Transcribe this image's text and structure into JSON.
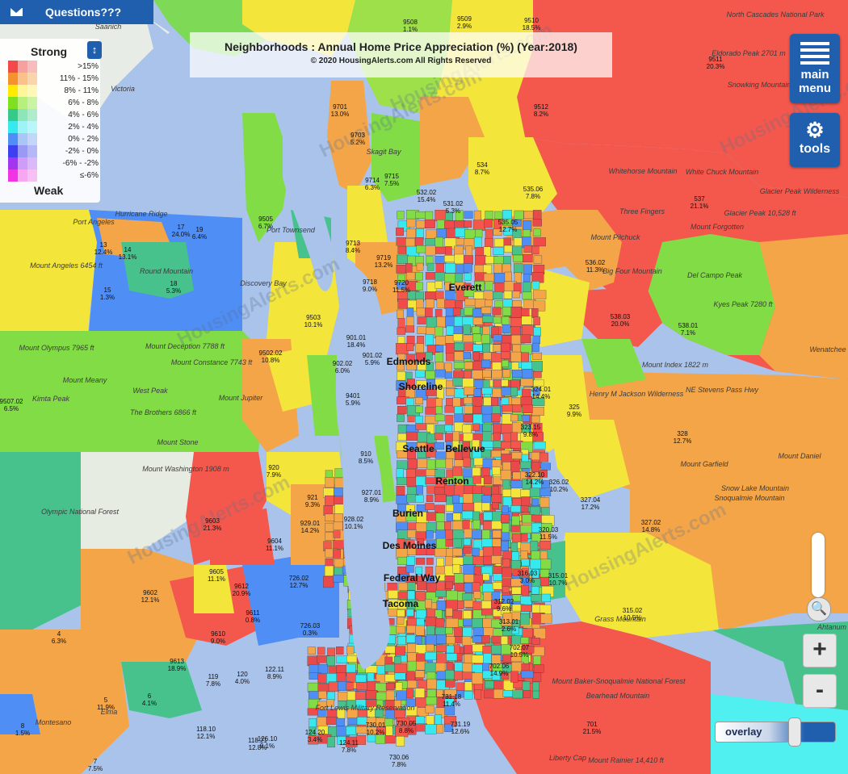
{
  "questions": {
    "label": "Questions???"
  },
  "title": {
    "heading": "Neighborhoods : Annual Home Price Appreciation (%) (Year:2018)",
    "copyright": "© 2020 HousingAlerts.com All Rights Reserved"
  },
  "legend": {
    "top": "Strong",
    "bottom": "Weak",
    "rows": [
      {
        "label": ">15%",
        "c1": "#f24a4a",
        "c2": "#f7a0a0"
      },
      {
        "label": "11% - 15%",
        "c1": "#f5922f",
        "c2": "#f8c28a"
      },
      {
        "label": "8% - 11%",
        "c1": "#ffea00",
        "c2": "#fff59a"
      },
      {
        "label": "6% - 8%",
        "c1": "#7ee01f",
        "c2": "#b8f07e"
      },
      {
        "label": "4% - 6%",
        "c1": "#36c98c",
        "c2": "#8ee6b8"
      },
      {
        "label": "2% - 4%",
        "c1": "#37e9ef",
        "c2": "#9df3f6"
      },
      {
        "label": "0% - 2%",
        "c1": "#4f8ef5",
        "c2": "#a9c6f7"
      },
      {
        "label": "-2% - 0%",
        "c1": "#3f3ff2",
        "c2": "#9a9af5"
      },
      {
        "label": "-6% - -2%",
        "c1": "#a234f2",
        "c2": "#cf9cf7"
      },
      {
        "label": "≤-6%",
        "c1": "#f233e3",
        "c2": "#f7a6ef"
      }
    ]
  },
  "buttons": {
    "menu": "main menu",
    "tools": "tools",
    "zoom_in": "+",
    "zoom_out": "-",
    "overlay": "overlay"
  },
  "icons": {
    "mail": "mail-icon",
    "menu": "hamburger-icon",
    "tools": "gear-icon",
    "zoom": "magnifier-icon",
    "legend_toggle": "expand-vertical-icon"
  },
  "map": {
    "watermark": "HousingAlerts.com",
    "cities": [
      "Seattle",
      "Bellevue",
      "Tacoma",
      "Everett",
      "Edmonds",
      "Shoreline",
      "Burien",
      "Des Moines",
      "Renton",
      "Federal Way"
    ],
    "places": [
      "Saanich",
      "Victoria",
      "Port Angeles",
      "Mount Angeles 6454 ft",
      "Mount Olympus 7965 ft",
      "Mount Deception 7788 ft",
      "Mount Constance 7743 ft",
      "The Brothers 6866 ft",
      "Mount Washington 1908 m",
      "Olympic National Forest",
      "Mount Stone",
      "Mount Jupiter",
      "Mount Meany",
      "West Peak",
      "Kimta Peak",
      "Hurricane Ridge",
      "Round Mountain",
      "Discovery Bay",
      "Port Townsend",
      "Skagit Bay",
      "North Cascades National Park",
      "Eldorado Peak 2701 m",
      "Snowking Mountain",
      "Whitehorse Mountain",
      "White Chuck Mountain",
      "Three Fingers",
      "Mount Forgotten",
      "Glacier Peak 10,528 ft",
      "Glacier Peak Wilderness",
      "Mount Pilchuck",
      "Big Four Mountain",
      "Del Campo Peak",
      "Kyes Peak 7280 ft",
      "Mount Index 1822 m",
      "Henry M Jackson Wilderness",
      "NE Stevens Pass Hwy",
      "Wenatchee",
      "Mount Garfield",
      "Mount Daniel",
      "Snoqualmie Mountain",
      "Snow Lake Mountain",
      "Mount Baker-Snoqualmie National Forest",
      "Bearhead Mountain",
      "Mount Rainier 14,410 ft",
      "Liberty Cap",
      "Grass Mountain",
      "Fort Lewis Military Reservation",
      "Montesano",
      "Elma",
      "Ahtanum"
    ],
    "region_labels": [
      {
        "id": "9509",
        "v": "2.9%"
      },
      {
        "id": "9510",
        "v": "18.5%"
      },
      {
        "id": "9508",
        "v": "1.1%"
      },
      {
        "id": "9511",
        "v": "20.3%"
      },
      {
        "id": "9512",
        "v": "8.2%"
      },
      {
        "id": "9701",
        "v": "13.0%"
      },
      {
        "id": "9703",
        "v": "5.2%"
      },
      {
        "id": "9714",
        "v": "6.3%"
      },
      {
        "id": "9715",
        "v": "7.5%"
      },
      {
        "id": "9505",
        "v": "6.7%"
      },
      {
        "id": "9713",
        "v": "8.4%"
      },
      {
        "id": "9719",
        "v": "13.2%"
      },
      {
        "id": "9718",
        "v": "9.0%"
      },
      {
        "id": "9720",
        "v": "11.5%"
      },
      {
        "id": "9503",
        "v": "10.1%"
      },
      {
        "id": "9502.02",
        "v": "10.8%"
      },
      {
        "id": "535.06",
        "v": "7.8%"
      },
      {
        "id": "537",
        "v": "21.1%"
      },
      {
        "id": "536.02",
        "v": "11.3%"
      },
      {
        "id": "538.03",
        "v": "20.0%"
      },
      {
        "id": "538.01",
        "v": "7.1%"
      },
      {
        "id": "534",
        "v": "8.7%"
      },
      {
        "id": "532.02",
        "v": "15.4%"
      },
      {
        "id": "531.02",
        "v": "5.3%"
      },
      {
        "id": "535.05",
        "v": "12.7%"
      },
      {
        "id": "325",
        "v": "9.9%"
      },
      {
        "id": "328",
        "v": "12.7%"
      },
      {
        "id": "324.01",
        "v": "14.4%"
      },
      {
        "id": "323.15",
        "v": "9.8%"
      },
      {
        "id": "322.10",
        "v": "14.2%"
      },
      {
        "id": "326.02",
        "v": "10.2%"
      },
      {
        "id": "327.04",
        "v": "17.2%"
      },
      {
        "id": "327.02",
        "v": "14.8%"
      },
      {
        "id": "320.03",
        "v": "11.5%"
      },
      {
        "id": "315.01",
        "v": "10.7%"
      },
      {
        "id": "315.02",
        "v": "10.5%"
      },
      {
        "id": "316.03",
        "v": "3.0%"
      },
      {
        "id": "312.02",
        "v": "9.6%"
      },
      {
        "id": "313.01",
        "v": "2.6%"
      },
      {
        "id": "702.07",
        "v": "10.5%"
      },
      {
        "id": "702.06",
        "v": "14.9%"
      },
      {
        "id": "701",
        "v": "21.5%"
      },
      {
        "id": "731.19",
        "v": "12.6%"
      },
      {
        "id": "731.18",
        "v": "11.4%"
      },
      {
        "id": "730.05",
        "v": "8.8%"
      },
      {
        "id": "730.01",
        "v": "10.2%"
      },
      {
        "id": "730.06",
        "v": "7.8%"
      },
      {
        "id": "124.20",
        "v": "3.4%"
      },
      {
        "id": "124.11",
        "v": "7.8%"
      },
      {
        "id": "126.10",
        "v": "9.1%"
      },
      {
        "id": "118.21",
        "v": "12.8%"
      },
      {
        "id": "118.10",
        "v": "12.1%"
      },
      {
        "id": "119",
        "v": "7.8%"
      },
      {
        "id": "120",
        "v": "4.0%"
      },
      {
        "id": "122.11",
        "v": "8.9%"
      },
      {
        "id": "9613",
        "v": "18.9%"
      },
      {
        "id": "9610",
        "v": "9.0%"
      },
      {
        "id": "9612",
        "v": "20.9%"
      },
      {
        "id": "9611",
        "v": "0.8%"
      },
      {
        "id": "9605",
        "v": "11.1%"
      },
      {
        "id": "9602",
        "v": "12.1%"
      },
      {
        "id": "9603",
        "v": "21.3%"
      },
      {
        "id": "9604",
        "v": "11.1%"
      },
      {
        "id": "726.03",
        "v": "0.3%"
      },
      {
        "id": "726.02",
        "v": "12.7%"
      },
      {
        "id": "921",
        "v": "9.3%"
      },
      {
        "id": "920",
        "v": "7.9%"
      },
      {
        "id": "929.01",
        "v": "14.2%"
      },
      {
        "id": "928.02",
        "v": "10.1%"
      },
      {
        "id": "927.01",
        "v": "8.9%"
      },
      {
        "id": "9401",
        "v": "5.9%"
      },
      {
        "id": "910",
        "v": "8.5%"
      },
      {
        "id": "902.02",
        "v": "6.0%"
      },
      {
        "id": "901.02",
        "v": "5.9%"
      },
      {
        "id": "901.01",
        "v": "18.4%"
      },
      {
        "id": "18",
        "v": "5.3%"
      },
      {
        "id": "15",
        "v": "1.3%"
      },
      {
        "id": "14",
        "v": "13.1%"
      },
      {
        "id": "13",
        "v": "12.4%"
      },
      {
        "id": "17",
        "v": "24.0%"
      },
      {
        "id": "19",
        "v": "6.4%"
      },
      {
        "id": "9507.02",
        "v": "6.5%"
      },
      {
        "id": "4",
        "v": "6.3%"
      },
      {
        "id": "5",
        "v": "11.9%"
      },
      {
        "id": "6",
        "v": "4.1%"
      },
      {
        "id": "7",
        "v": "7.5%"
      },
      {
        "id": "8",
        "v": "1.5%"
      }
    ]
  }
}
